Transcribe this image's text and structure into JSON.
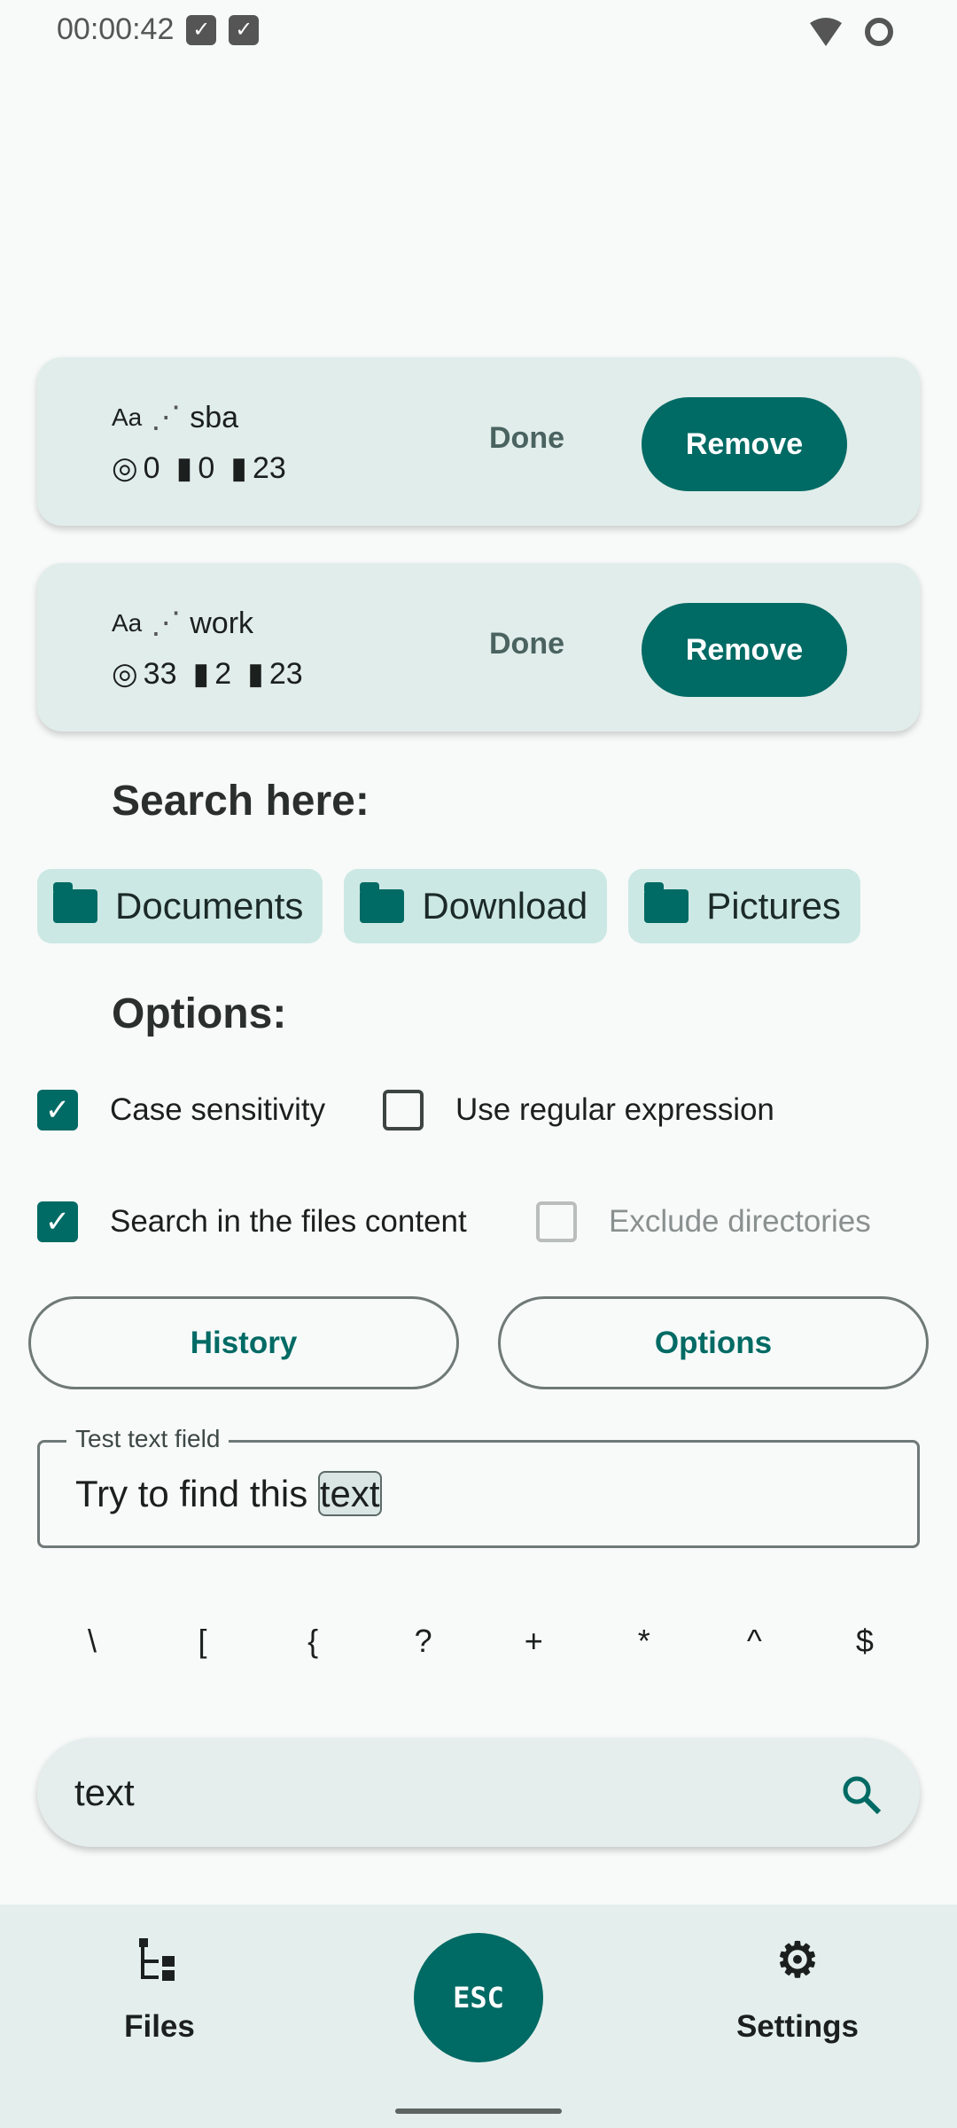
{
  "status_bar": {
    "time": "00:00:42",
    "icons": [
      "check-search-icon",
      "check-search-icon",
      "wifi-icon",
      "battery-icon"
    ]
  },
  "searches": [
    {
      "case_label": "Aa",
      "regex_icon": "regex-off-icon",
      "query": "sba",
      "matches": "0",
      "files_matched": "0",
      "files_total": "23",
      "done_label": "Done",
      "remove_label": "Remove"
    },
    {
      "case_label": "Aa",
      "regex_icon": "regex-off-icon",
      "query": "work",
      "matches": "33",
      "files_matched": "2",
      "files_total": "23",
      "done_label": "Done",
      "remove_label": "Remove"
    }
  ],
  "search_here": {
    "title": "Search here:",
    "folders": [
      "Documents",
      "Download",
      "Pictures"
    ]
  },
  "options": {
    "title": "Options:",
    "items": [
      {
        "label": "Case sensitivity",
        "checked": true,
        "enabled": true
      },
      {
        "label": "Use regular expression",
        "checked": false,
        "enabled": true
      },
      {
        "label": "Search in the files content",
        "checked": true,
        "enabled": true
      },
      {
        "label": "Exclude directories",
        "checked": false,
        "enabled": false
      }
    ]
  },
  "buttons": {
    "history": "History",
    "options": "Options"
  },
  "test_field": {
    "label": "Test text field",
    "value_prefix": "Try to find this ",
    "value_match": "text"
  },
  "special_keys": [
    "\\",
    "[",
    "{",
    "?",
    "+",
    "*",
    "^",
    "$"
  ],
  "search_bar": {
    "value": "text"
  },
  "bottom_nav": {
    "files": "Files",
    "esc": "ESC",
    "settings": "Settings"
  },
  "colors": {
    "accent": "#006a64",
    "card": "#e1edea",
    "chip": "#cce8e4"
  }
}
